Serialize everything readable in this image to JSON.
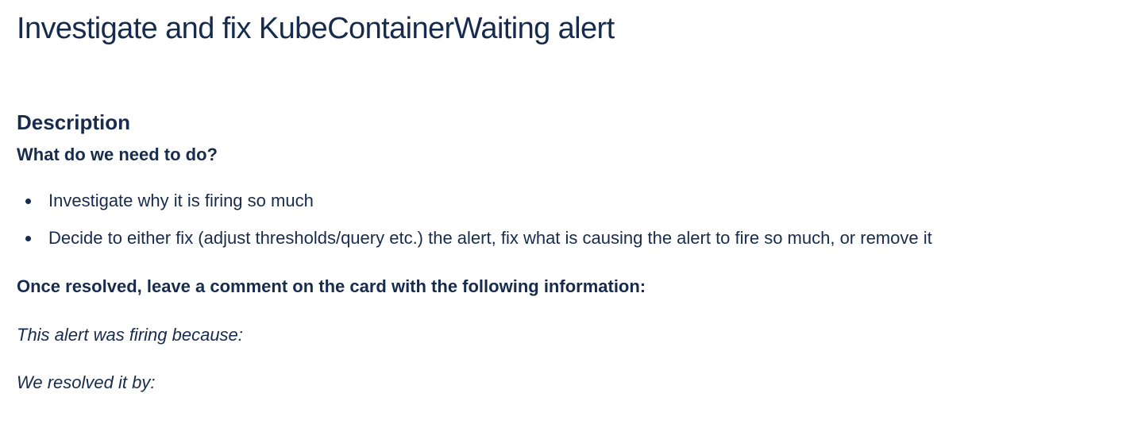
{
  "page": {
    "title": "Investigate and fix KubeContainerWaiting alert"
  },
  "description": {
    "heading": "Description",
    "todo_heading": "What do we need to do?",
    "todo_items": [
      {
        "text": "Investigate why it is firing so much"
      },
      {
        "text": "Decide to either fix (adjust thresholds/query etc.) the alert, fix what is causing the alert to fire so much, or remove it"
      }
    ],
    "resolved_heading": "Once resolved, leave a comment on the card with the following information:",
    "firing_reason_prompt": "This alert was firing because:",
    "resolution_prompt": "We resolved it by:"
  },
  "colors": {
    "text": "#172B4D",
    "background": "#FFFFFF"
  }
}
